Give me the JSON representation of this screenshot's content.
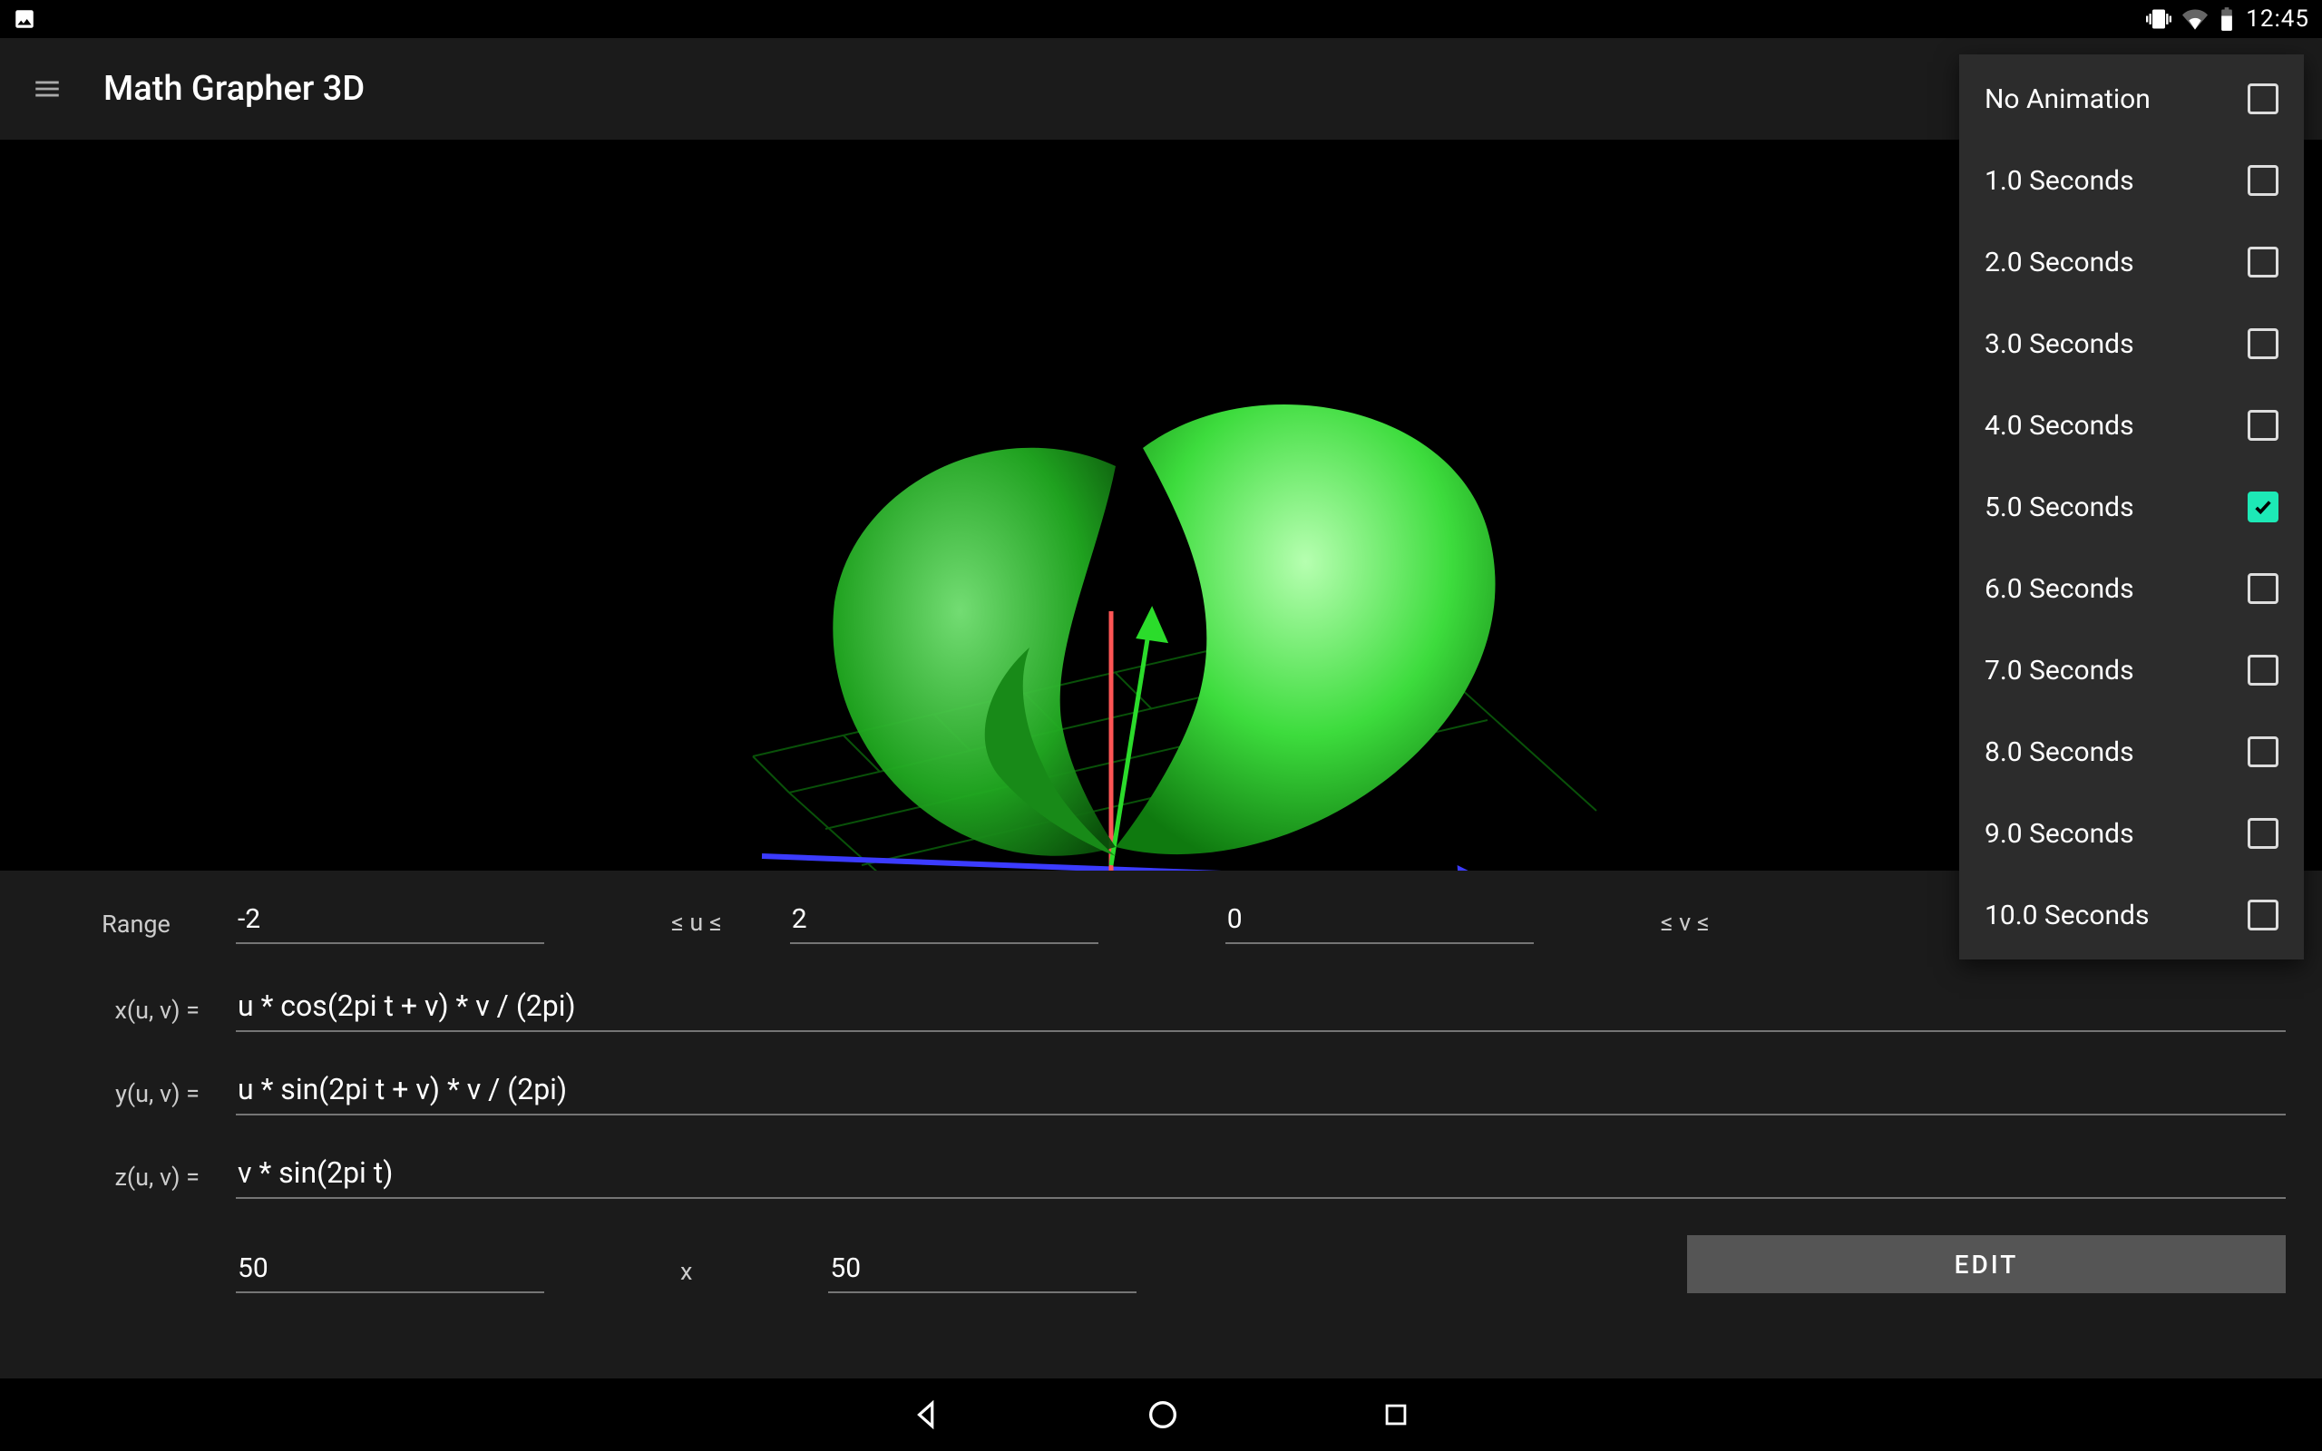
{
  "statusbar": {
    "time": "12:45"
  },
  "appbar": {
    "title": "Math Grapher 3D"
  },
  "panel": {
    "range_label": "Range",
    "u_min": "-2",
    "u_sep": "≤ u ≤",
    "u_max": "2",
    "v_min": "0",
    "v_sep": "≤ v ≤",
    "x_label": "x(u, v) =",
    "x_expr": "u * cos(2pi t + v) * v / (2pi)",
    "y_label": "y(u, v) =",
    "y_expr": "u * sin(2pi t + v) * v / (2pi)",
    "z_label": "z(u, v) =",
    "z_expr": "v * sin(2pi t)",
    "res_u": "50",
    "res_sep": "x",
    "res_v": "50",
    "edit_btn": "EDIT"
  },
  "dropdown": {
    "items": [
      {
        "label": "No Animation",
        "checked": false
      },
      {
        "label": "1.0 Seconds",
        "checked": false
      },
      {
        "label": "2.0 Seconds",
        "checked": false
      },
      {
        "label": "3.0 Seconds",
        "checked": false
      },
      {
        "label": "4.0 Seconds",
        "checked": false
      },
      {
        "label": "5.0 Seconds",
        "checked": true
      },
      {
        "label": "6.0 Seconds",
        "checked": false
      },
      {
        "label": "7.0 Seconds",
        "checked": false
      },
      {
        "label": "8.0 Seconds",
        "checked": false
      },
      {
        "label": "9.0 Seconds",
        "checked": false
      },
      {
        "label": "10.0 Seconds",
        "checked": false
      }
    ]
  }
}
